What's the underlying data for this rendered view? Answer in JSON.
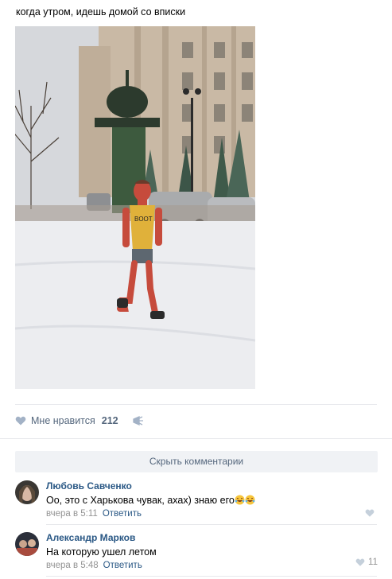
{
  "post": {
    "text": "когда утром, идешь домой со вписки"
  },
  "actions": {
    "like_label": "Мне нравится",
    "like_count": "212"
  },
  "comments_toggle": "Скрыть комментарии",
  "comments": [
    {
      "author": "Любовь Савченко",
      "text": "Оо, это с Харькова чувак, ахах) знаю его",
      "time": "вчера в 5:11",
      "reply": "Ответить",
      "likes": ""
    },
    {
      "author": "Александр Марков",
      "text": "На которую ушел летом",
      "time": "вчера в 5:48",
      "reply": "Ответить",
      "likes": "11"
    }
  ],
  "colors": {
    "link": "#2a5885",
    "muted": "#939393",
    "action": "#55677d",
    "button_bg": "#f0f2f5"
  },
  "icons": [
    "heart-icon",
    "share-icon",
    "laughing-emoji-icon"
  ]
}
